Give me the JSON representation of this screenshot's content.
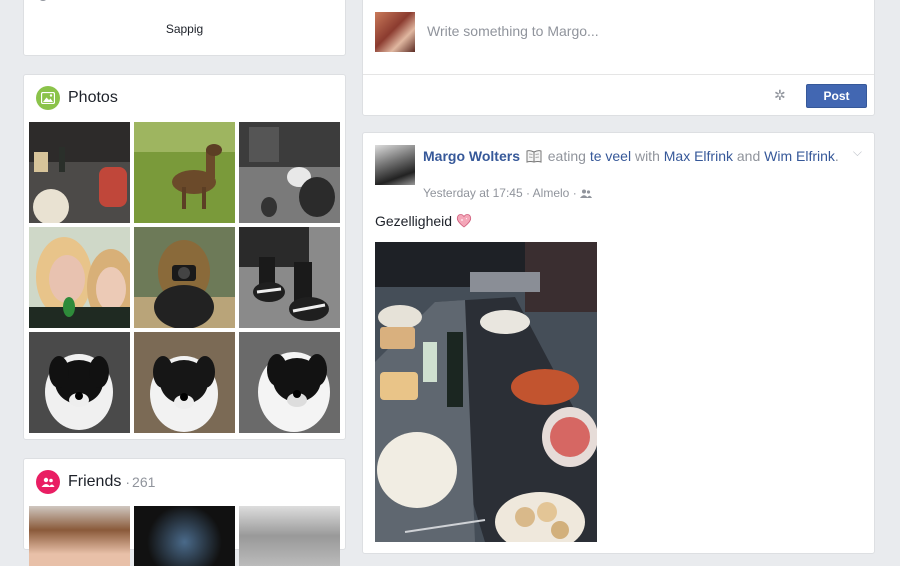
{
  "about": {
    "text": "Sappig"
  },
  "photos": {
    "title": "Photos",
    "items": [
      {
        "name": "photo-dinner-table"
      },
      {
        "name": "photo-deer-on-grass"
      },
      {
        "name": "photo-person-with-cat"
      },
      {
        "name": "photo-two-girls-selfie"
      },
      {
        "name": "photo-girl-with-camera"
      },
      {
        "name": "photo-sneakers-on-floor"
      },
      {
        "name": "photo-dog-1"
      },
      {
        "name": "photo-dog-2"
      },
      {
        "name": "photo-dog-3"
      }
    ]
  },
  "friends": {
    "title": "Friends",
    "separator": "·",
    "count": "261"
  },
  "composer": {
    "placeholder": "Write something to Margo...",
    "post_label": "Post"
  },
  "post": {
    "author": "Margo Wolters",
    "activity": "eating",
    "activity_object": "te veel",
    "with_text": "with",
    "friend1": "Max Elfrink",
    "and_text": "and",
    "friend2": "Wim Elfrink",
    "suffix": ".",
    "timestamp": "Yesterday at 17:45",
    "location": "Almelo",
    "dot": "·",
    "text": "Gezelligheid"
  },
  "colors": {
    "photos_icon_bg": "#8bc34a",
    "friends_icon_bg": "#e91e63",
    "post_button": "#4267b2",
    "link": "#365899"
  }
}
